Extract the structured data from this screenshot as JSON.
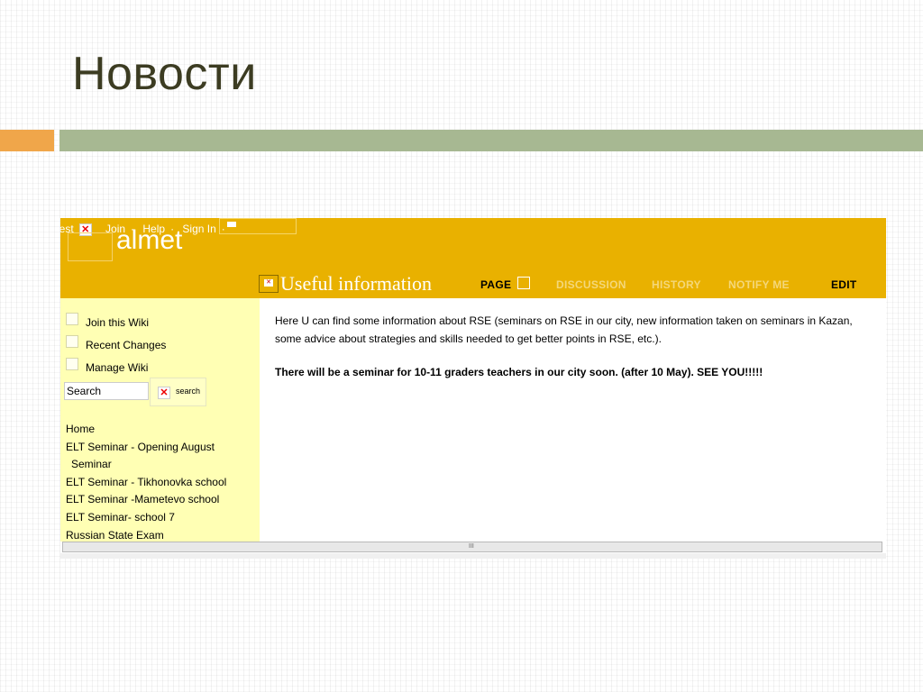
{
  "slide": {
    "title": "Новости"
  },
  "wiki": {
    "top_nav": {
      "guest": "uest",
      "join": "Join",
      "help": "Help",
      "sign_in": "Sign In"
    },
    "logo_text": "almet",
    "page_title": "Useful information",
    "tabs": {
      "page": "PAGE",
      "discussion": "DISCUSSION",
      "history": "HISTORY",
      "notify": "NOTIFY ME",
      "edit": "EDIT"
    },
    "sidebar": {
      "links": [
        "Join this Wiki",
        "Recent Changes",
        "Manage Wiki"
      ],
      "search_value": "Search",
      "search_button": "search",
      "nav": [
        "Home",
        "ELT Seminar - Opening August",
        "Seminar",
        "ELT Seminar - Tikhonovka school",
        "ELT Seminar -Mametevo school",
        "ELT Seminar- school 7",
        "Russian State Exam"
      ]
    },
    "content": {
      "intro": "Here U can find some information about RSE (seminars on RSE in our city, new information taken on seminars in Kazan, some advice about strategies and skills needed to get better points in RSE, etc.).",
      "announcement": "There will be a seminar for 10-11 graders teachers in our city soon. (after 10 May). SEE YOU!!!!!"
    },
    "scrollbar_grip": "III"
  },
  "colors": {
    "header": "#e9b100",
    "sidebar": "#ffffb4",
    "accent_orange": "#f0a64a",
    "accent_green": "#a7b892"
  }
}
